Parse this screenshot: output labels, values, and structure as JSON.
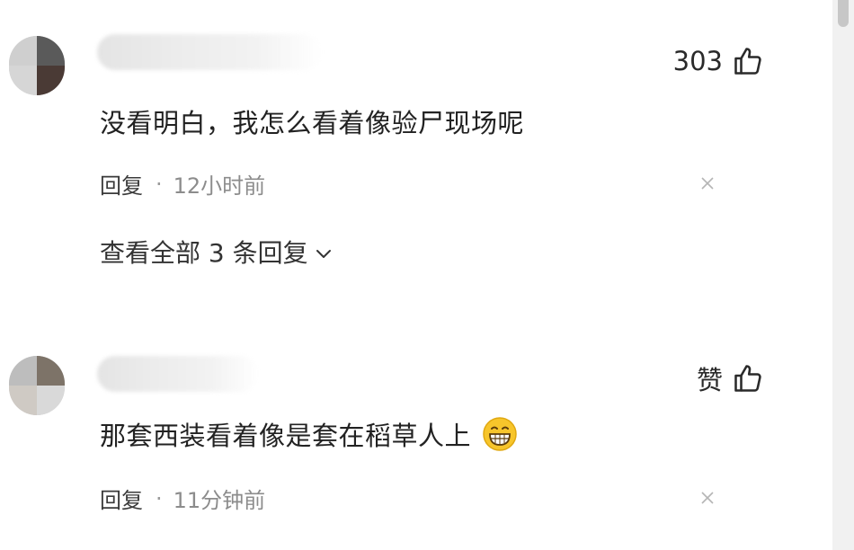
{
  "comments": [
    {
      "like_count": "303",
      "text": "没看明白，我怎么看着像验尸现场呢",
      "reply_label": "回复",
      "separator": "·",
      "time": "12小时前",
      "view_all_replies": "查看全部 3 条回复"
    },
    {
      "like_label": "赞",
      "text": "那套西装看着像是套在稻草人上",
      "emoji": "grinning-face-emoji",
      "reply_label": "回复",
      "separator": "·",
      "time": "11分钟前"
    }
  ],
  "icons": {
    "like": "thumbs-up-icon",
    "close": "close-icon",
    "expand": "chevron-down-icon"
  },
  "colors": {
    "text": "#222222",
    "meta": "#8c8c8c",
    "background": "#ffffff"
  }
}
